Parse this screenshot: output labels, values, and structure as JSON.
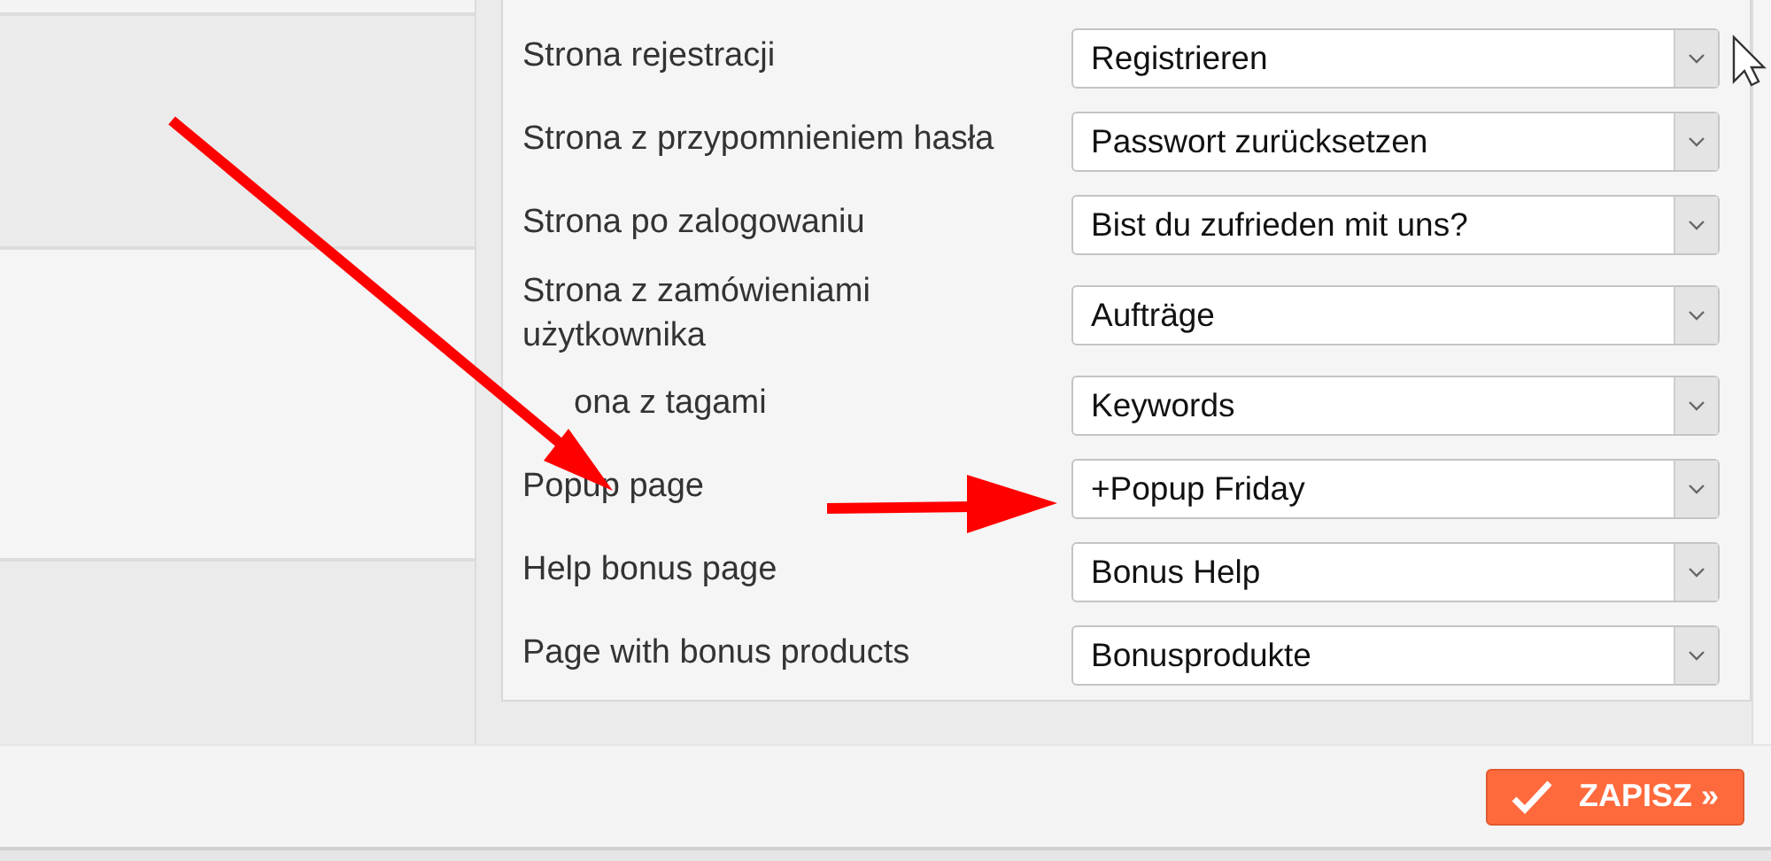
{
  "settings_rows": [
    {
      "label": "Strona rejestracji",
      "value": "Registrieren"
    },
    {
      "label": "Strona z przypomnieniem hasła",
      "value": "Passwort zurücksetzen"
    },
    {
      "label": "Strona po zalogowaniu",
      "value": "Bist du zufrieden mit uns?"
    },
    {
      "label": "Strona z zamówieniami użytkownika",
      "value": "Aufträge"
    },
    {
      "label": "ona z tagami",
      "kind": "covered",
      "value": "Keywords"
    },
    {
      "label": "Popup page",
      "value": "+Popup Friday"
    },
    {
      "label": "Help bonus page",
      "value": "Bonus Help"
    },
    {
      "label": "Page with bonus products",
      "value": "Bonusprodukte"
    }
  ],
  "save_button": {
    "label": "ZAPISZ »"
  }
}
